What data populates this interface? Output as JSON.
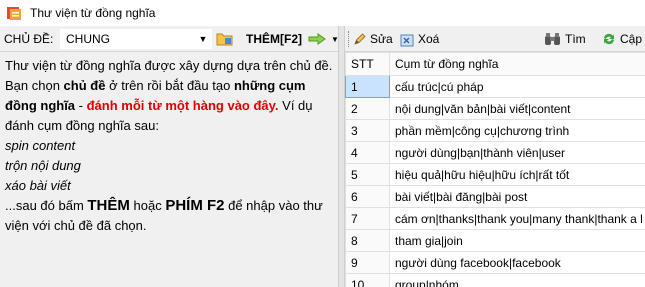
{
  "window": {
    "title": "Thư viện từ đồng nghĩa"
  },
  "left_toolbar": {
    "topic_label": "CHỦ ĐỀ:",
    "topic_value": "CHUNG",
    "add_label": "THÊM[F2]"
  },
  "instructions": {
    "p1_a": "Thư viện từ đồng nghĩa được xây dựng dựa trên chủ đề. Bạn chọn ",
    "p1_b": "chủ đề",
    "p1_c": " ở trên rồi bắt đầu tạo ",
    "p1_d": "những cụm đồng nghĩa",
    "p1_e": " - ",
    "p1_f": "đánh mỗi từ một hàng vào đây.",
    "p1_g": " Ví dụ đánh cụm đồng nghĩa sau:",
    "ex1": "spin content",
    "ex2": "trộn nội dung",
    "ex3": "xáo bài viết",
    "p2_a": "...sau đó bấm ",
    "p2_b": "THÊM",
    "p2_c": " hoặc ",
    "p2_d": "PHÍM F2",
    "p2_e": " để nhập vào thư viện với chủ đề đã chọn."
  },
  "right_toolbar": {
    "edit_label": "Sửa",
    "delete_label": "Xoá",
    "search_label": "Tìm",
    "update_label": "Cập"
  },
  "table": {
    "col_stt": "STT",
    "col_phrase": "Cụm từ đồng nghĩa",
    "rows": [
      {
        "stt": "1",
        "phrase": "cấu trúc|cú pháp"
      },
      {
        "stt": "2",
        "phrase": "nội dung|văn bản|bài viết|content"
      },
      {
        "stt": "3",
        "phrase": "phần mềm|công cụ|chương trình"
      },
      {
        "stt": "4",
        "phrase": "người dùng|bạn|thành viên|user"
      },
      {
        "stt": "5",
        "phrase": "hiệu quả|hữu hiệu|hữu ích|rất tốt"
      },
      {
        "stt": "6",
        "phrase": "bài viết|bài đăng|bài post"
      },
      {
        "stt": "7",
        "phrase": "cám ơn|thanks|thank you|many thank|thank a l"
      },
      {
        "stt": "8",
        "phrase": "tham gia|join"
      },
      {
        "stt": "9",
        "phrase": "người dùng facebook|facebook"
      },
      {
        "stt": "10",
        "phrase": "group|nhóm"
      }
    ]
  }
}
